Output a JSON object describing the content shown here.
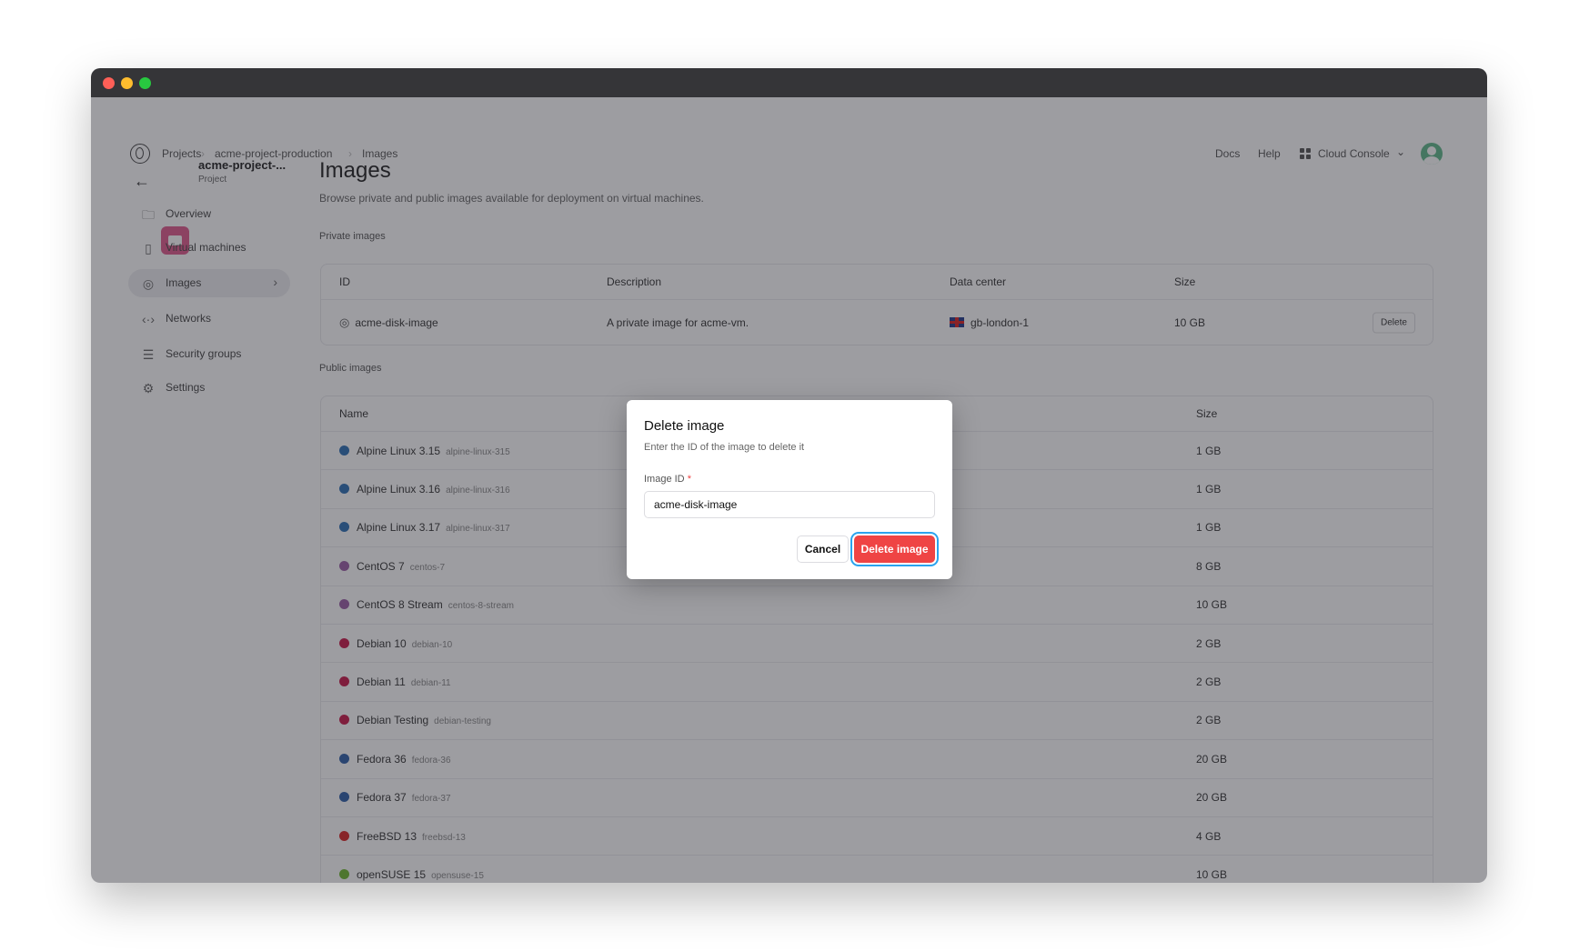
{
  "header": {
    "breadcrumb": [
      "Projects",
      "acme-project-production",
      "Images"
    ],
    "links": [
      "Docs",
      "Help"
    ],
    "console_label": "Cloud Console"
  },
  "sidebar": {
    "project_name": "acme-project-...",
    "project_type": "Project",
    "items": [
      {
        "label": "Overview",
        "icon": "folder-icon"
      },
      {
        "label": "Virtual machines",
        "icon": "server-icon"
      },
      {
        "label": "Images",
        "icon": "disk-icon",
        "selected": true
      },
      {
        "label": "Networks",
        "icon": "network-icon"
      },
      {
        "label": "Security groups",
        "icon": "security-groups-icon"
      },
      {
        "label": "Settings",
        "icon": "gear-icon"
      }
    ]
  },
  "main": {
    "title": "Images",
    "subtitle": "Browse private and public images available for deployment on virtual machines.",
    "private": {
      "heading": "Private images",
      "columns": [
        "ID",
        "Description",
        "Data center",
        "Size"
      ],
      "rows": [
        {
          "id": "acme-disk-image",
          "description": "A private image for acme-vm.",
          "datacenter": "gb-london-1",
          "size": "10 GB",
          "action": "Delete"
        }
      ]
    },
    "public": {
      "heading": "Public images",
      "columns": [
        "Name",
        "Size"
      ],
      "rows": [
        {
          "name": "Alpine Linux 3.15",
          "slug": "alpine-linux-315",
          "size": "1 GB",
          "color": "#2d6fb5"
        },
        {
          "name": "Alpine Linux 3.16",
          "slug": "alpine-linux-316",
          "size": "1 GB",
          "color": "#2d6fb5"
        },
        {
          "name": "Alpine Linux 3.17",
          "slug": "alpine-linux-317",
          "size": "1 GB",
          "color": "#2d6fb5"
        },
        {
          "name": "CentOS 7",
          "slug": "centos-7",
          "size": "8 GB",
          "color": "#9b5ea6"
        },
        {
          "name": "CentOS 8 Stream",
          "slug": "centos-8-stream",
          "size": "10 GB",
          "color": "#9b5ea6"
        },
        {
          "name": "Debian 10",
          "slug": "debian-10",
          "size": "2 GB",
          "color": "#c9184a"
        },
        {
          "name": "Debian 11",
          "slug": "debian-11",
          "size": "2 GB",
          "color": "#c9184a"
        },
        {
          "name": "Debian Testing",
          "slug": "debian-testing",
          "size": "2 GB",
          "color": "#c9184a"
        },
        {
          "name": "Fedora 36",
          "slug": "fedora-36",
          "size": "20 GB",
          "color": "#2f5fa8"
        },
        {
          "name": "Fedora 37",
          "slug": "fedora-37",
          "size": "20 GB",
          "color": "#2f5fa8"
        },
        {
          "name": "FreeBSD 13",
          "slug": "freebsd-13",
          "size": "4 GB",
          "color": "#d92626"
        },
        {
          "name": "openSUSE 15",
          "slug": "opensuse-15",
          "size": "10 GB",
          "color": "#6fb82e"
        }
      ]
    }
  },
  "modal": {
    "title": "Delete image",
    "description": "Enter the ID of the image to delete it",
    "field_label": "Image ID",
    "required_mark": "*",
    "field_value": "acme-disk-image",
    "cancel": "Cancel",
    "confirm": "Delete image",
    "danger_color": "#ef4444"
  }
}
